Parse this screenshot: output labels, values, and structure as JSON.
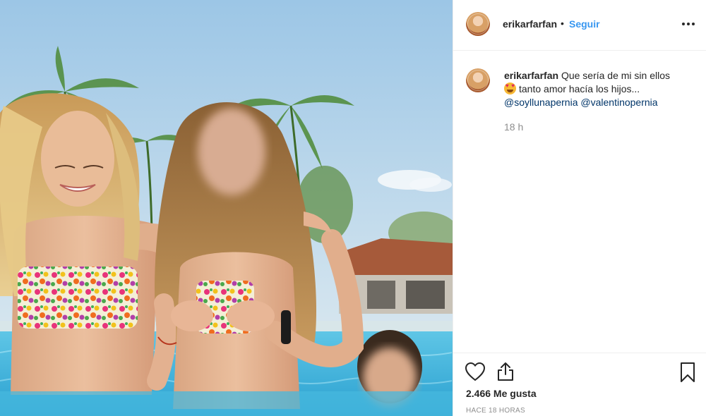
{
  "post": {
    "username": "erikarfarfan",
    "separator": "•",
    "follow_label": "Seguir",
    "more_icon": "more-options-icon"
  },
  "caption": {
    "username": "erikarfarfan",
    "text_line1": "Que sería de mi sin ellos",
    "emoji": "heart-eyes-emoji",
    "text_line2": "tanto amor hacía los hijos...",
    "mention_1": "@soyllunapernia",
    "mention_2": "@valentinopernia",
    "relative_time": "18 h"
  },
  "actions": {
    "like_icon": "heart-icon",
    "share_icon": "share-icon",
    "save_icon": "bookmark-icon"
  },
  "stats": {
    "likes_label": "2.466 Me gusta",
    "timestamp": "HACE 18 HORAS"
  },
  "colors": {
    "link_blue": "#3897f0",
    "mention_blue": "#003569",
    "muted_gray": "#8e8e8e"
  }
}
